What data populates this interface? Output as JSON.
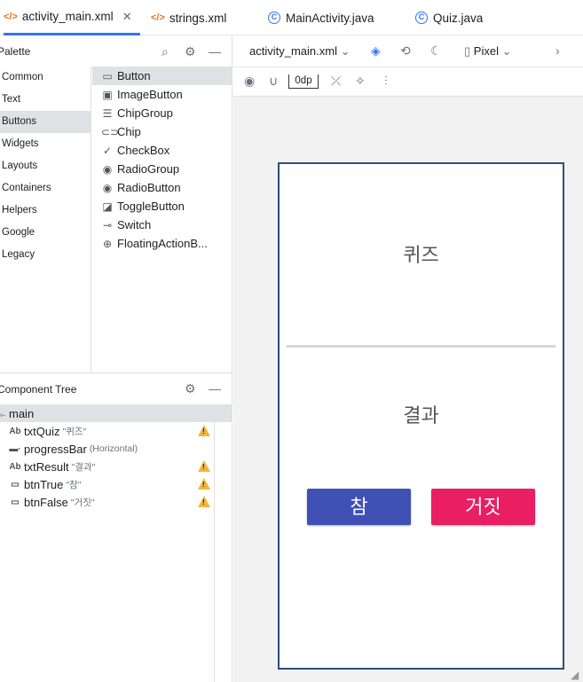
{
  "tabs": [
    {
      "label": "activity_main.xml",
      "icon": "xml-icon",
      "active": true
    },
    {
      "label": "strings.xml",
      "icon": "xml-icon"
    },
    {
      "label": "MainActivity.java",
      "icon": "java-class-icon"
    },
    {
      "label": "Quiz.java",
      "icon": "java-class-icon"
    }
  ],
  "palette": {
    "title": "Palette",
    "categories": [
      "Common",
      "Text",
      "Buttons",
      "Widgets",
      "Layouts",
      "Containers",
      "Helpers",
      "Google",
      "Legacy"
    ],
    "selected_category": "Buttons",
    "items": [
      {
        "label": "Button",
        "icon": "button-icon"
      },
      {
        "label": "ImageButton",
        "icon": "image-button-icon"
      },
      {
        "label": "ChipGroup",
        "icon": "chip-group-icon"
      },
      {
        "label": "Chip",
        "icon": "chip-icon"
      },
      {
        "label": "CheckBox",
        "icon": "checkbox-icon"
      },
      {
        "label": "RadioGroup",
        "icon": "radio-group-icon"
      },
      {
        "label": "RadioButton",
        "icon": "radio-button-icon"
      },
      {
        "label": "ToggleButton",
        "icon": "toggle-button-icon"
      },
      {
        "label": "Switch",
        "icon": "switch-icon"
      },
      {
        "label": "FloatingActionB...",
        "icon": "fab-icon"
      }
    ]
  },
  "component_tree": {
    "title": "Component Tree",
    "root": "main",
    "nodes": [
      {
        "type": "Ab",
        "name": "txtQuiz",
        "hint": "\"퀴즈\"",
        "warning": true
      },
      {
        "type": "bar",
        "name": "progressBar",
        "hint": "(Horizontal)",
        "warning": false
      },
      {
        "type": "Ab",
        "name": "txtResult",
        "hint": "\"결과\"",
        "warning": true
      },
      {
        "type": "box",
        "name": "btnTrue",
        "hint": "\"참\"",
        "warning": true
      },
      {
        "type": "box",
        "name": "btnFalse",
        "hint": "\"거짓\"",
        "warning": true
      }
    ]
  },
  "editor_toolbar": {
    "file": "activity_main.xml",
    "device": "Pixel",
    "margin": "0dp"
  },
  "preview": {
    "quiz_text": "퀴즈",
    "result_text": "결과",
    "true_button": "참",
    "false_button": "거짓",
    "true_color": "#3f51b5",
    "false_color": "#e91e63"
  }
}
